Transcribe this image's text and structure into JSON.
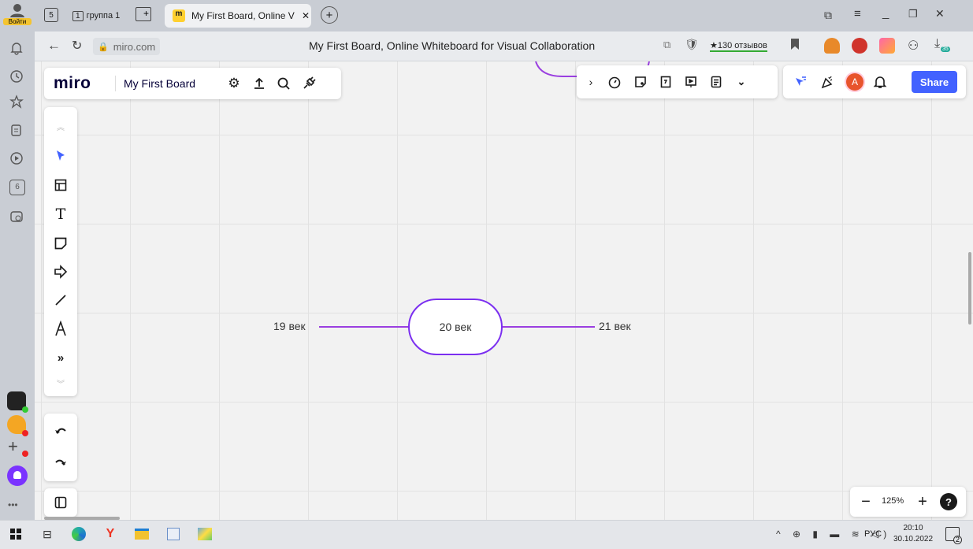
{
  "browser": {
    "login_label": "Войти",
    "tab_group_count": "1",
    "tab_group_label": "группа 1",
    "active_tab_title": "My First Board, Online V",
    "address": "miro.com",
    "page_title": "My First Board, Online Whiteboard for Visual Collaboration",
    "reviews_label": "★130 отзывов",
    "download_count": "35",
    "side_count": "6"
  },
  "miro": {
    "logo": "miro",
    "board_name": "My First Board",
    "share_label": "Share",
    "avatar_letter": "A",
    "zoom": "125%",
    "help": "?"
  },
  "mindmap": {
    "center": "20 век",
    "left": "19 век",
    "right": "21 век"
  },
  "taskbar": {
    "lang": "РУС",
    "time": "20:10",
    "date": "30.10.2022",
    "notifications": "2"
  },
  "colors": {
    "accent": "#4262ff",
    "mindmap_line": "#9a3fe0",
    "avatar": "#e8542c"
  }
}
